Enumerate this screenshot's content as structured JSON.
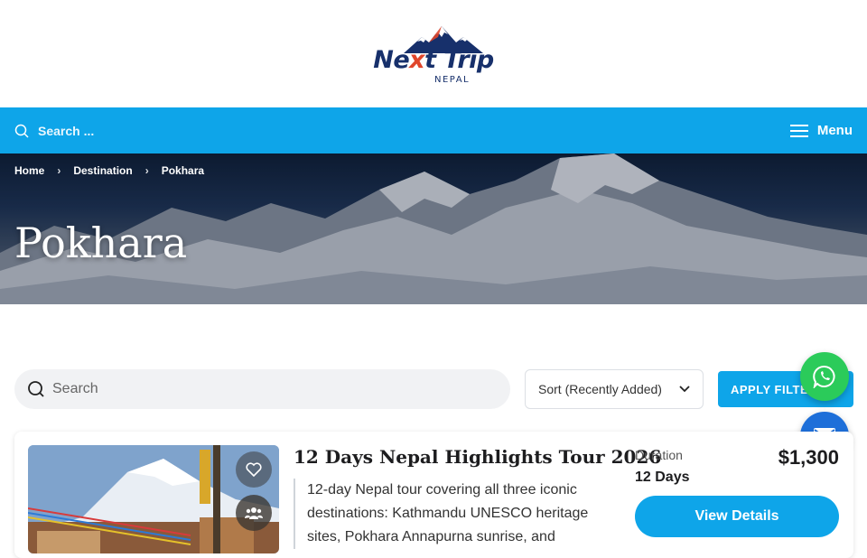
{
  "header": {
    "logo_main_1": "Ne",
    "logo_main_x": "x",
    "logo_main_2": "t Trip",
    "logo_sub": "NEPAL"
  },
  "nav": {
    "search_label": "Search ...",
    "menu_label": "Menu"
  },
  "breadcrumb": [
    {
      "label": "Home"
    },
    {
      "label": "Destination"
    },
    {
      "label": "Pokhara"
    }
  ],
  "hero": {
    "title": "Pokhara"
  },
  "filters": {
    "search_placeholder": "Search",
    "sort_value": "Sort (Recently Added)",
    "apply_label": "APPLY FILTERS"
  },
  "tour": {
    "title": "12 Days Nepal Highlights Tour 2026",
    "description": "12-day Nepal tour covering all three iconic destinations: Kathmandu UNESCO heritage sites, Pokhara Annapurna sunrise, and",
    "duration_label": "Duration",
    "duration_value": "12 Days",
    "price": "$1,300",
    "button_label": "View Details"
  },
  "colors": {
    "accent": "#0ea5e9",
    "whatsapp": "#2bcb5a",
    "mail": "#1e6fd9",
    "logo_blue": "#17306b",
    "logo_red": "#e0462b"
  },
  "icons": {
    "nav_search": "search-icon",
    "menu": "hamburger-icon",
    "breadcrumb_sep": "chevron-right-icon",
    "sort": "chevron-down-icon",
    "whatsapp": "whatsapp-icon",
    "mail": "mail-icon",
    "wishlist": "heart-icon",
    "group": "group-icon"
  }
}
